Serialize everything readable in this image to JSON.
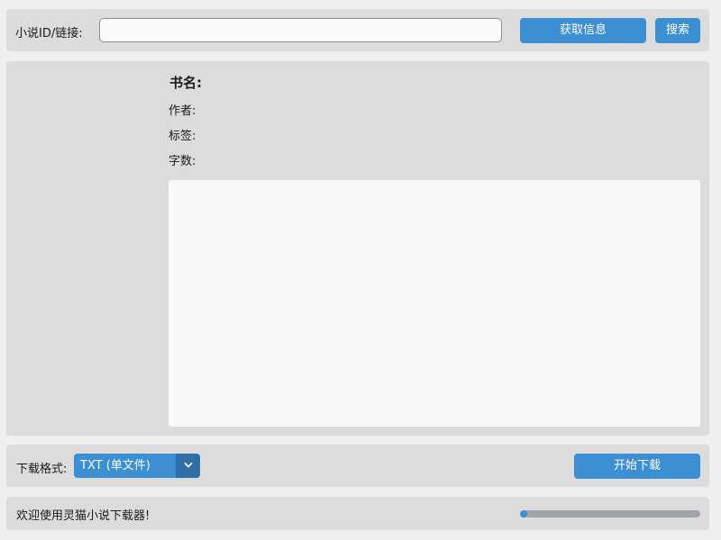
{
  "top_bar": {
    "id_label": "小说ID/链接:",
    "id_input_value": "",
    "id_input_placeholder": "",
    "fetch_button": "获取信息",
    "search_button": "搜索"
  },
  "book_info": {
    "title_label": "书名:",
    "author_label": "作者:",
    "tags_label": "标签:",
    "wordcount_label": "字数:",
    "description": ""
  },
  "download": {
    "format_label": "下载格式:",
    "format_selected": "TXT (单文件)",
    "start_button": "开始下载"
  },
  "status": {
    "message": "欢迎使用灵猫小说下载器!",
    "progress": 0.04
  },
  "colors": {
    "accent": "#3d8fd4",
    "accent_dark": "#2f6ea6",
    "panel_bg": "#dcdcdc",
    "window_bg": "#efefef",
    "progress_track": "#9ea4aa"
  }
}
